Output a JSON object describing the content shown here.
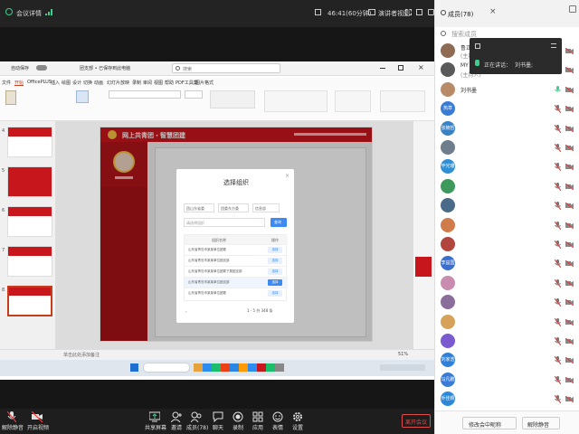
{
  "meeting": {
    "title": "会议详情",
    "timer": "46:41(60分钟)",
    "speaker_view": "演讲者视图",
    "members_count_label": "成员(78)",
    "speaking_label": "正在讲话：",
    "speaking_name": "刘书墨;",
    "toolbar": {
      "mute": "解除静音",
      "video": "开启视频",
      "share": "共享屏幕",
      "invite": "邀请",
      "members": "成员(78)",
      "chat": "聊天",
      "record": "录制",
      "apps": "应用",
      "reactions": "表情",
      "settings": "设置",
      "leave": "离开会议"
    }
  },
  "panel": {
    "search_placeholder": "搜索成员",
    "footer_rename": "修改会中昵称",
    "footer_unmute": "解除静音",
    "members": [
      {
        "name": "鲁正杰",
        "sub": "(主持人,我)",
        "avatar": "",
        "color": "#8e6b52",
        "mic": "on"
      },
      {
        "name": "MY ANSWER",
        "sub": "(主持人)",
        "avatar": "",
        "color": "#5a5a5a",
        "mic": "on"
      },
      {
        "name": "刘书墨",
        "sub": "",
        "avatar": "",
        "color": "#b98a68",
        "mic": "speaking"
      },
      {
        "name": "",
        "sub": "",
        "avatar": "热草",
        "color": "#3a7bd5",
        "mic": "off"
      },
      {
        "name": "",
        "sub": "",
        "avatar": "张楠哲",
        "color": "#3b82c4",
        "mic": "off"
      },
      {
        "name": "",
        "sub": "",
        "avatar": "",
        "color": "#6f7d8c",
        "mic": "off"
      },
      {
        "name": "",
        "sub": "",
        "avatar": "毕光珊",
        "color": "#2f8fd6",
        "mic": "off"
      },
      {
        "name": "",
        "sub": "",
        "avatar": "",
        "color": "#3d9a5c",
        "mic": "off"
      },
      {
        "name": "",
        "sub": "",
        "avatar": "",
        "color": "#4a6a8a",
        "mic": "off"
      },
      {
        "name": "",
        "sub": "",
        "avatar": "",
        "color": "#d07c4a",
        "mic": "off"
      },
      {
        "name": "",
        "sub": "",
        "avatar": "",
        "color": "#b0463e",
        "mic": "off"
      },
      {
        "name": "",
        "sub": "",
        "avatar": "李益国",
        "color": "#3a6fd0",
        "mic": "off"
      },
      {
        "name": "",
        "sub": "",
        "avatar": "",
        "color": "#c98bb0",
        "mic": "off"
      },
      {
        "name": "",
        "sub": "",
        "avatar": "",
        "color": "#8a6d9a",
        "mic": "off"
      },
      {
        "name": "",
        "sub": "",
        "avatar": "",
        "color": "#d6a25a",
        "mic": "off"
      },
      {
        "name": "",
        "sub": "",
        "avatar": "",
        "color": "#7a5acf",
        "mic": "off"
      },
      {
        "name": "",
        "sub": "",
        "avatar": "刘家浩",
        "color": "#2f80d6",
        "mic": "off"
      },
      {
        "name": "",
        "sub": "",
        "avatar": "马凡鹏",
        "color": "#3a7bd5",
        "mic": "off"
      },
      {
        "name": "",
        "sub": "",
        "avatar": "乔佳颖",
        "color": "#2d88d8",
        "mic": "off"
      }
    ]
  },
  "ppt": {
    "window_label": "自动保存",
    "file_name": "团支部 • 已保存到此电脑",
    "search_placeholder": "搜索",
    "tabs": [
      "文件",
      "开始",
      "OfficePLUS",
      "插入",
      "绘图",
      "设计",
      "切换",
      "动画",
      "幻灯片放映",
      "录制",
      "审阅",
      "视图",
      "帮助",
      "PDF工具集",
      "图片格式"
    ],
    "slide_numbers": [
      "4",
      "5",
      "6",
      "7",
      "8"
    ],
    "notes_label": "单击此处添加备注",
    "zoom": "51%"
  },
  "slide": {
    "app_title": "网上共青团・智慧团建",
    "dialog_title": "选择组织",
    "select1": "团山东省委",
    "select2": "团委东方委",
    "select3": "信息部",
    "input_placeholder": "请选择组织",
    "query_button": "查询",
    "col_name": "组织名称",
    "col_action": "操作",
    "rows": [
      {
        "name": "山东省青岛市某某单位团委",
        "action": "选择"
      },
      {
        "name": "山东省青岛市某某单位团支部",
        "action": "选择"
      },
      {
        "name": "山东省青岛市某某单位团委下属团支部",
        "action": "选择"
      },
      {
        "name": "山东省青岛市某某单位团支部",
        "action": "选择"
      },
      {
        "name": "山东省青岛市某某单位团委",
        "action": "选择"
      }
    ],
    "pagination": "1 - 5 共 348 条"
  }
}
